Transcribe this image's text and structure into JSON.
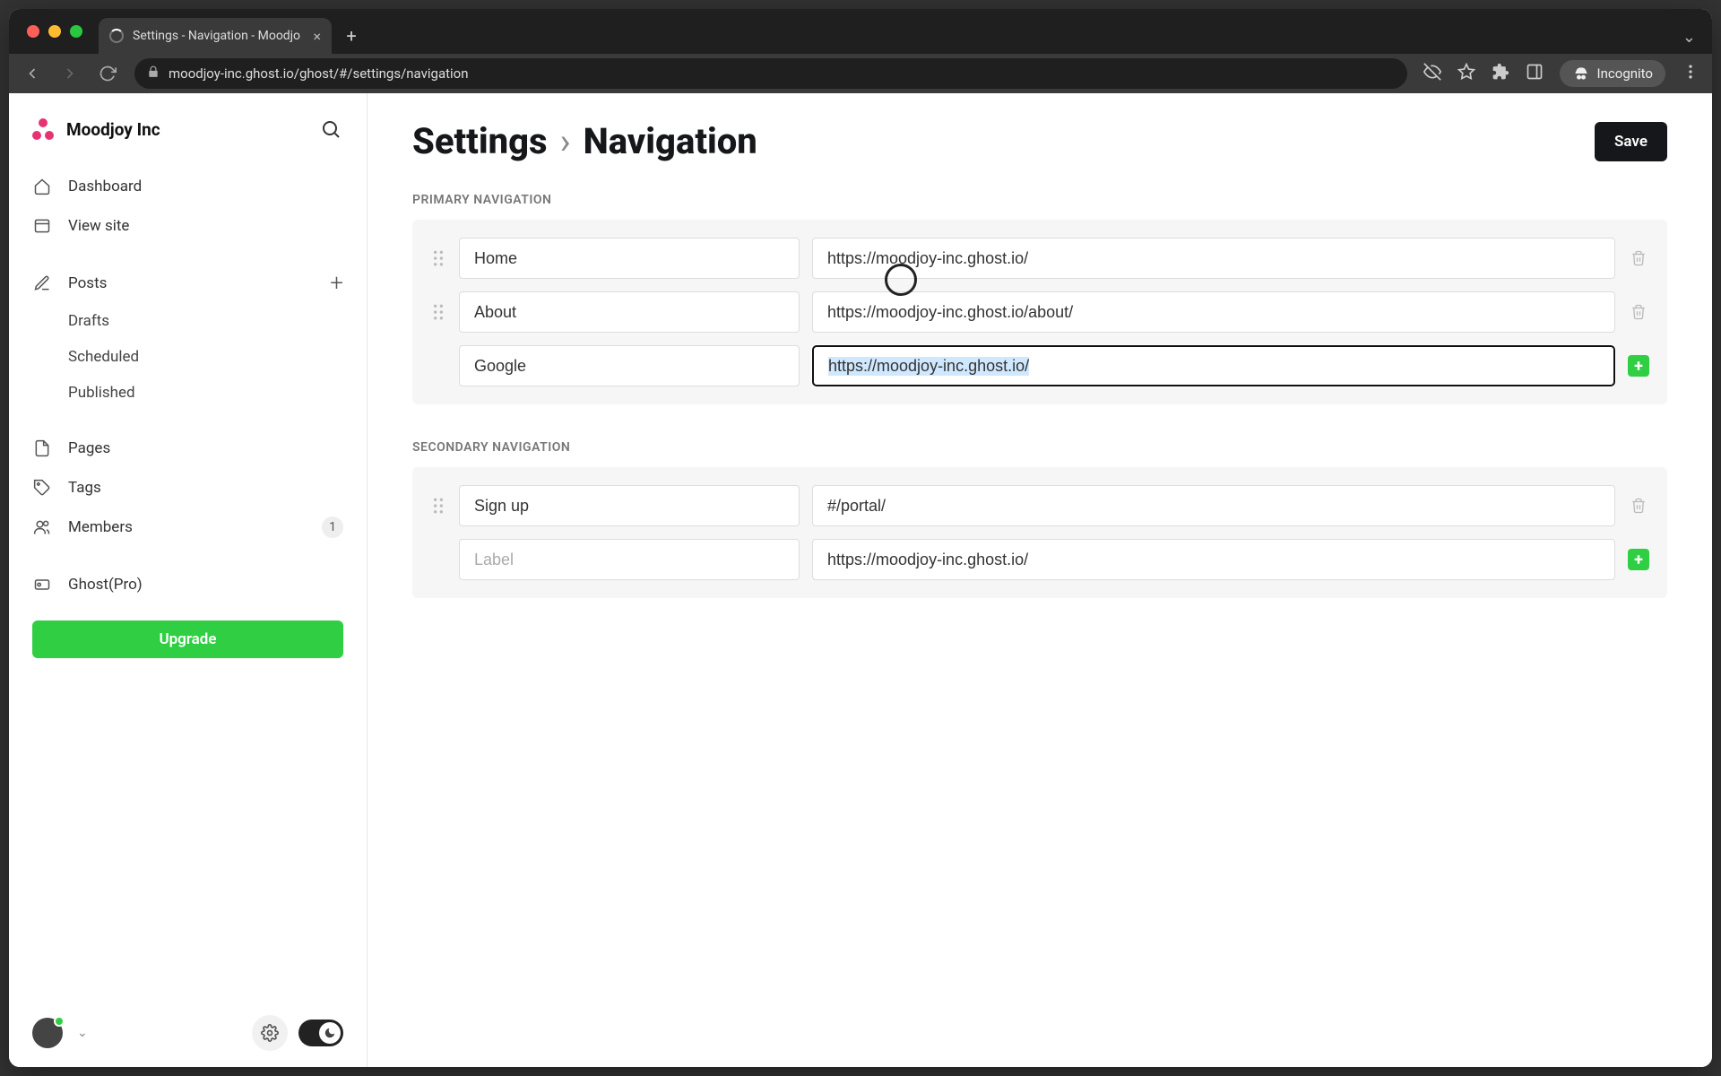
{
  "browser": {
    "tab_title": "Settings - Navigation - Moodjo",
    "url": "moodjoy-inc.ghost.io/ghost/#/settings/navigation",
    "incognito_label": "Incognito"
  },
  "sidebar": {
    "site_name": "Moodjoy Inc",
    "items": {
      "dashboard": "Dashboard",
      "view_site": "View site",
      "posts": "Posts",
      "drafts": "Drafts",
      "scheduled": "Scheduled",
      "published": "Published",
      "pages": "Pages",
      "tags": "Tags",
      "members": "Members",
      "members_count": "1",
      "ghost_pro": "Ghost(Pro)"
    },
    "upgrade_label": "Upgrade"
  },
  "header": {
    "crumb_parent": "Settings",
    "crumb_current": "Navigation",
    "save_label": "Save"
  },
  "primary": {
    "label": "PRIMARY NAVIGATION",
    "rows": [
      {
        "label": "Home",
        "url": "https://moodjoy-inc.ghost.io/"
      },
      {
        "label": "About",
        "url": "https://moodjoy-inc.ghost.io/about/"
      }
    ],
    "new": {
      "label": "Google",
      "url": "https://moodjoy-inc.ghost.io/"
    }
  },
  "secondary": {
    "label": "SECONDARY NAVIGATION",
    "rows": [
      {
        "label": "Sign up",
        "url": "#/portal/"
      }
    ],
    "new": {
      "label_placeholder": "Label",
      "url": "https://moodjoy-inc.ghost.io/"
    }
  }
}
